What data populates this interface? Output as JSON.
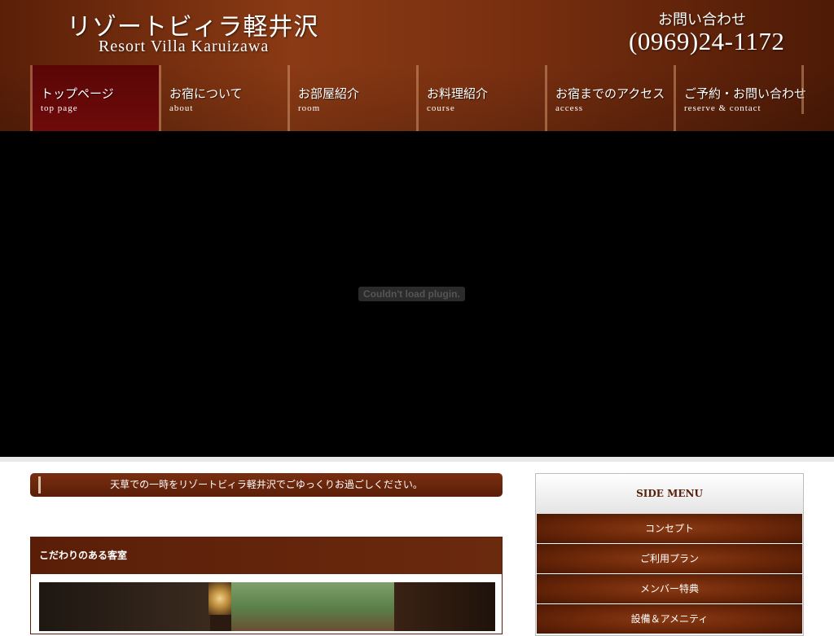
{
  "header": {
    "title_jp": "リゾートビィラ軽井沢",
    "title_en": "Resort Villa Karuizawa",
    "contact_label": "お問い合わせ",
    "phone": "(0969)24-1172"
  },
  "nav": {
    "items": [
      {
        "jp": "トップページ",
        "en": "top page"
      },
      {
        "jp": "お宿について",
        "en": "about"
      },
      {
        "jp": "お部屋紹介",
        "en": "room"
      },
      {
        "jp": "お料理紹介",
        "en": "course"
      },
      {
        "jp": "お宿までのアクセス",
        "en": "access"
      },
      {
        "jp": "ご予約・お問い合わせ",
        "en": "reserve & contact"
      }
    ],
    "active_index": 0
  },
  "plugin": {
    "message": "Couldn't load plugin."
  },
  "main": {
    "banner_text": "天草での一時をリゾートビィラ軽井沢でごゆっくりお過ごしください。",
    "panel_title": "こだわりのある客室"
  },
  "sidebar": {
    "title": "SIDE MENU",
    "items": [
      {
        "label": "コンセプト"
      },
      {
        "label": "ご利用プラン"
      },
      {
        "label": "メンバー特典"
      },
      {
        "label": "設備＆アメニティ"
      }
    ]
  },
  "colors": {
    "brand_brown": "#6b2a0e",
    "active_nav": "#6e0a0a",
    "plugin_bg": "#000000"
  }
}
